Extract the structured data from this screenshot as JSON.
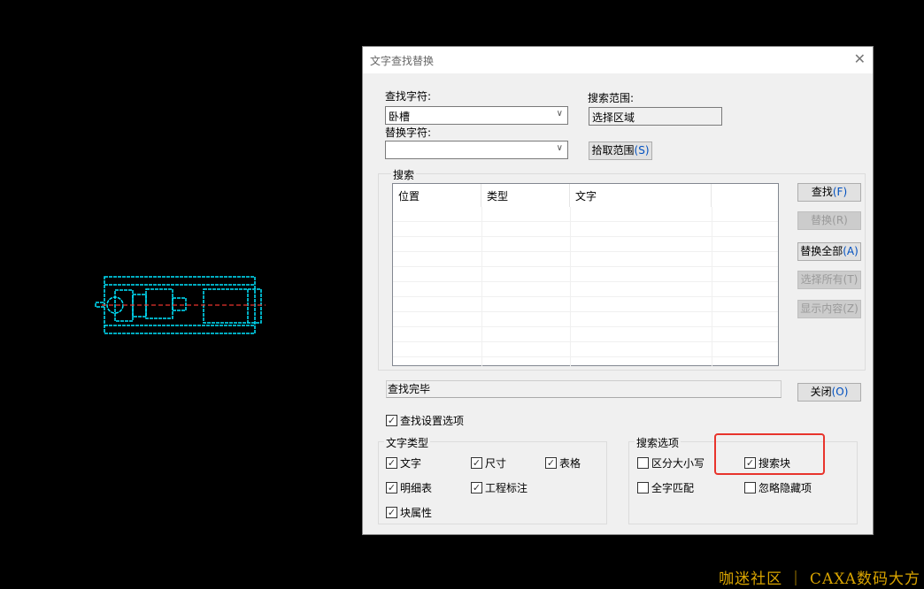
{
  "dialog": {
    "title": "文字查找替换",
    "find_label": "查找字符:",
    "find_value": "卧槽",
    "replace_label": "替换字符:",
    "replace_value": "",
    "scope_label": "搜索范围:",
    "scope_value": "选择区域",
    "pick_scope": "拾取范围",
    "pick_scope_key": "(S)",
    "search_group": "搜索",
    "columns": [
      "位置",
      "类型",
      "文字",
      ""
    ],
    "buttons": [
      {
        "label": "查找",
        "key": "(F)",
        "enabled": true
      },
      {
        "label": "替换",
        "key": "(R)",
        "enabled": false
      },
      {
        "label": "替换全部",
        "key": "(A)",
        "enabled": true
      },
      {
        "label": "选择所有",
        "key": "(T)",
        "enabled": false
      },
      {
        "label": "显示内容",
        "key": "(Z)",
        "enabled": false
      }
    ],
    "status": "查找完毕",
    "close_label": "关闭",
    "close_key": "(O)",
    "settings_option": {
      "label": "查找设置选项",
      "checked": true
    },
    "text_type_group": "文字类型",
    "text_types": [
      {
        "label": "文字",
        "checked": true
      },
      {
        "label": "尺寸",
        "checked": true
      },
      {
        "label": "表格",
        "checked": true
      },
      {
        "label": "明细表",
        "checked": true
      },
      {
        "label": "工程标注",
        "checked": true
      },
      {
        "label": "块属性",
        "checked": true
      }
    ],
    "search_options_group": "搜索选项",
    "search_options": [
      {
        "label": "区分大小写",
        "checked": false
      },
      {
        "label": "搜索块",
        "checked": true
      },
      {
        "label": "全字匹配",
        "checked": false
      },
      {
        "label": "忽略隐藏项",
        "checked": false
      }
    ]
  },
  "colors": {
    "highlight": "#e8342c",
    "cad_line": "#00e5ff",
    "watermark": "#d9a400"
  },
  "watermark": "咖迷社区 ｜ CAXA数码大方"
}
